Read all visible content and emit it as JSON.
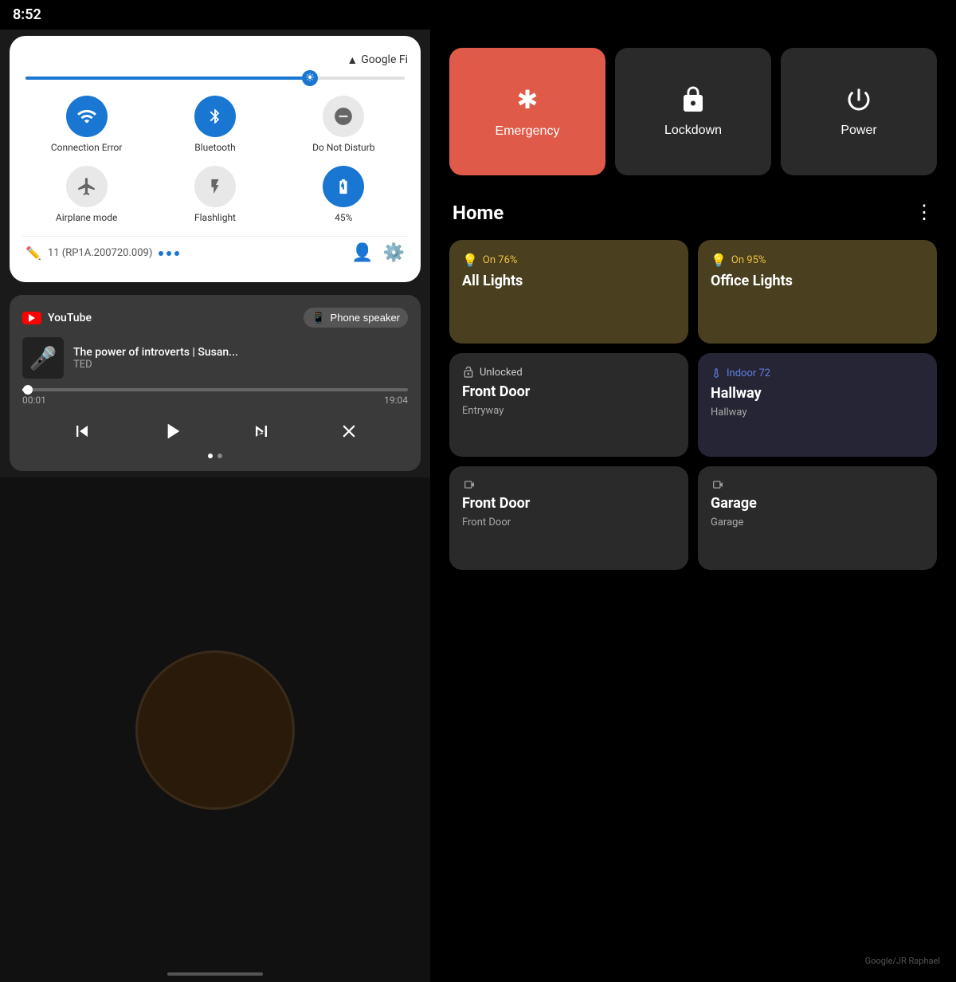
{
  "status_bar": {
    "time": "8:52"
  },
  "carrier": {
    "name": "Google Fi"
  },
  "brightness": {
    "value": 75
  },
  "quick_tiles": [
    {
      "id": "wifi",
      "label": "Connection Error",
      "state": "active",
      "icon": "wifi"
    },
    {
      "id": "bluetooth",
      "label": "Bluetooth",
      "state": "active",
      "icon": "bluetooth"
    },
    {
      "id": "dnd",
      "label": "Do Not Disturb",
      "state": "inactive",
      "icon": "minus-circle"
    },
    {
      "id": "airplane",
      "label": "Airplane mode",
      "state": "inactive",
      "icon": "airplane"
    },
    {
      "id": "flashlight",
      "label": "Flashlight",
      "state": "inactive",
      "icon": "flashlight"
    },
    {
      "id": "battery",
      "label": "45%",
      "state": "active",
      "icon": "battery"
    }
  ],
  "version": {
    "build": "11 (RP1A.200720.009)",
    "dots": 3
  },
  "media": {
    "app": "YouTube",
    "output": "Phone speaker",
    "title": "The power of introverts | Susan...",
    "artist": "TED",
    "current_time": "00:01",
    "total_time": "19:04",
    "progress_percent": 1.5
  },
  "power_buttons": [
    {
      "id": "emergency",
      "label": "Emergency",
      "icon": "asterisk",
      "style": "emergency"
    },
    {
      "id": "lockdown",
      "label": "Lockdown",
      "icon": "lock",
      "style": "lockdown"
    },
    {
      "id": "power",
      "label": "Power",
      "icon": "power",
      "style": "power"
    }
  ],
  "home": {
    "title": "Home",
    "devices": [
      {
        "id": "all-lights",
        "status_icon": "💡",
        "status_text": "On 76%",
        "name": "All Lights",
        "sub": "",
        "style": "lights-on",
        "status_color": "yellow"
      },
      {
        "id": "office-lights",
        "status_icon": "💡",
        "status_text": "On 95%",
        "name": "Office Lights",
        "sub": "",
        "style": "lights-on",
        "status_color": "yellow"
      },
      {
        "id": "front-door-lock",
        "status_icon": "🔓",
        "status_text": "Unlocked",
        "name": "Front Door",
        "sub": "Entryway",
        "style": "lock-card",
        "status_color": "normal"
      },
      {
        "id": "hallway-temp",
        "status_icon": "🌡",
        "status_text": "Indoor 72",
        "name": "Hallway",
        "sub": "Hallway",
        "style": "temp-card",
        "status_color": "blue"
      },
      {
        "id": "front-door-cam",
        "status_icon": "📷",
        "status_text": "",
        "name": "Front Door",
        "sub": "Front Door",
        "style": "camera-card",
        "status_color": "normal"
      },
      {
        "id": "garage-cam",
        "status_icon": "📷",
        "status_text": "",
        "name": "Garage",
        "sub": "Garage",
        "style": "camera-card",
        "status_color": "normal"
      }
    ]
  }
}
